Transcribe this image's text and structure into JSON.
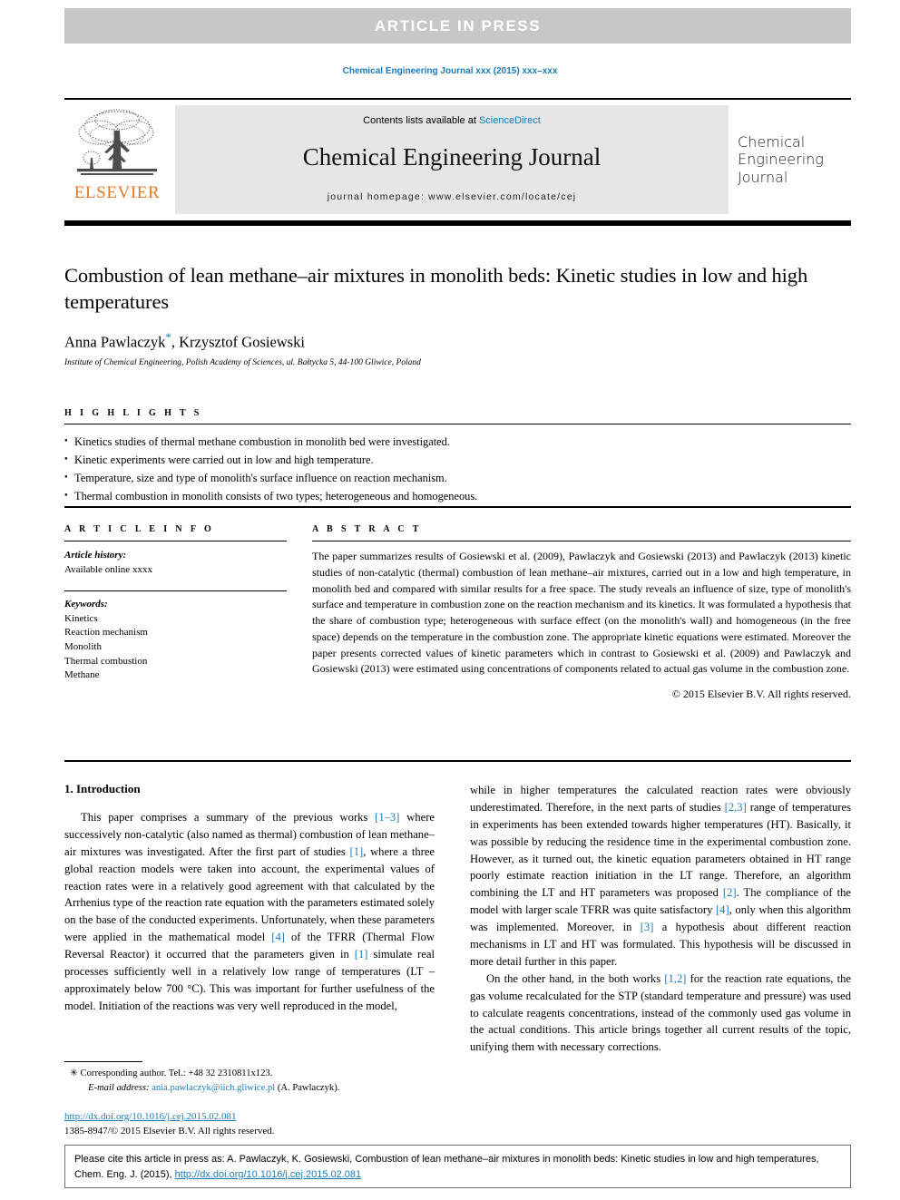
{
  "banner": {
    "text": "ARTICLE  IN  PRESS",
    "background": "#c6c7c9",
    "text_color": "#ffffff"
  },
  "running_head": {
    "text": "Chemical Engineering Journal xxx (2015) xxx–xxx",
    "color": "#1a7bb9"
  },
  "masthead": {
    "contents_prefix": "Contents lists available at ",
    "contents_link": "ScienceDirect",
    "journal_title": "Chemical Engineering Journal",
    "homepage": "journal homepage: www.elsevier.com/locate/cej",
    "publisher": "ELSEVIER",
    "publisher_color": "#e87722",
    "cover_title": "Chemical Engineering Journal",
    "link_color": "#1a7bb9"
  },
  "article": {
    "title": "Combustion of lean methane–air mixtures in monolith beds: Kinetic studies in low and high temperatures",
    "authors_part1": "Anna Pawlaczyk",
    "authors_star": "*",
    "authors_part2": ", Krzysztof Gosiewski",
    "affiliation": "Institute of Chemical Engineering, Polish Academy of Sciences, ul. Bałtycka 5, 44-100 Gliwice, Poland"
  },
  "highlights": {
    "label": "H I G H L I G H T S",
    "items": [
      "Kinetics studies of thermal methane combustion in monolith bed were investigated.",
      "Kinetic experiments were carried out in low and high temperature.",
      "Temperature, size and type of monolith's surface influence on reaction mechanism.",
      "Thermal combustion in monolith consists of two types; heterogeneous and homogeneous."
    ]
  },
  "article_info": {
    "label": "A R T I C L E    I N F O",
    "history_label": "Article history:",
    "history_value": "Available online xxxx",
    "keywords_label": "Keywords:",
    "keywords": [
      "Kinetics",
      "Reaction mechanism",
      "Monolith",
      "Thermal combustion",
      "Methane"
    ]
  },
  "abstract": {
    "label": "A B S T R A C T",
    "text": "The paper summarizes results of Gosiewski et al. (2009), Pawlaczyk and Gosiewski (2013) and Pawlaczyk (2013) kinetic studies of non-catalytic (thermal) combustion of lean methane–air mixtures, carried out in a low and high temperature, in monolith bed and compared with similar results for a free space. The study reveals an influence of size, type of monolith's surface and temperature in combustion zone on the reaction mechanism and its kinetics. It was formulated a hypothesis that the share of combustion type; heterogeneous with surface effect (on the monolith's wall) and homogeneous (in the free space) depends on the temperature in the combustion zone. The appropriate kinetic equations were estimated. Moreover the paper presents corrected values of kinetic parameters which in contrast to Gosiewski et al. (2009) and Pawlaczyk and Gosiewski (2013) were estimated using concentrations of components related to actual gas volume in the combustion zone.",
    "copyright": "© 2015 Elsevier B.V. All rights reserved."
  },
  "introduction": {
    "heading": "1. Introduction",
    "para1_a": "This paper comprises a summary of the previous works ",
    "para1_ref1": "[1–3]",
    "para1_b": " where successively non-catalytic (also named as thermal) combustion of lean methane–air mixtures was investigated. After the first part of studies ",
    "para1_ref2": "[1]",
    "para1_c": ", where a three global reaction models were taken into account, the experimental values of reaction rates were in a relatively good agreement with that calculated by the Arrhenius type of the reaction rate equation with the parameters estimated solely on the base of the conducted experiments. Unfortunately, when these parameters were applied in the mathematical model ",
    "para1_ref3": "[4]",
    "para1_d": " of the TFRR (Thermal Flow Reversal Reactor) it occurred that the parameters given in ",
    "para1_ref4": "[1]",
    "para1_e": " simulate real processes sufficiently well in a relatively low range of temperatures (LT – approximately below 700 °C). This was important for further usefulness of the model. Initiation of the reactions was very well reproduced in the model,",
    "para2_a": "while in higher temperatures the calculated reaction rates were obviously underestimated. Therefore, in the next parts of studies ",
    "para2_ref1": "[2,3]",
    "para2_b": " range of temperatures in experiments has been extended towards higher temperatures (HT). Basically, it was possible by reducing the residence time in the experimental combustion zone. However, as it turned out, the kinetic equation parameters obtained in HT range poorly estimate reaction initiation in the LT range. Therefore, an algorithm combining the LT and HT parameters was proposed ",
    "para2_ref2": "[2]",
    "para2_c": ". The compliance of the model with larger scale TFRR was quite satisfactory ",
    "para2_ref3": "[4]",
    "para2_d": ", only when this algorithm was implemented. Moreover, in ",
    "para2_ref4": "[3]",
    "para2_e": " a hypothesis about different reaction mechanisms in LT and HT was formulated. This hypothesis will be discussed in more detail further in this paper.",
    "para3_a": "On the other hand, in the both works ",
    "para3_ref1": "[1,2]",
    "para3_b": " for the reaction rate equations, the gas volume recalculated for the STP (standard temperature and pressure) was used to calculate reagents concentrations, instead of the commonly used gas volume in the actual conditions. This article brings together all current results of the topic, unifying them with necessary corrections."
  },
  "footnote": {
    "star": "✳",
    "corresponding": "Corresponding author. Tel.: +48 32 2310811x123.",
    "email_label": "E-mail address:",
    "email": "ania.pawlaczyk@iich.gliwice.pl",
    "email_suffix": "(A. Pawlaczyk)."
  },
  "doi_block": {
    "doi_url": "http://dx.doi.org/10.1016/j.cej.2015.02.081",
    "issn_line": "1385-8947/© 2015 Elsevier B.V. All rights reserved."
  },
  "cite_box": {
    "text_a": "Please cite this article in press as: A. Pawlaczyk, K. Gosiewski, Combustion of lean methane–air mixtures in monolith beds: Kinetic studies in low and high temperatures, Chem. Eng. J. (2015), ",
    "link": "http://dx.doi.org/10.1016/j.cej.2015.02.081"
  }
}
